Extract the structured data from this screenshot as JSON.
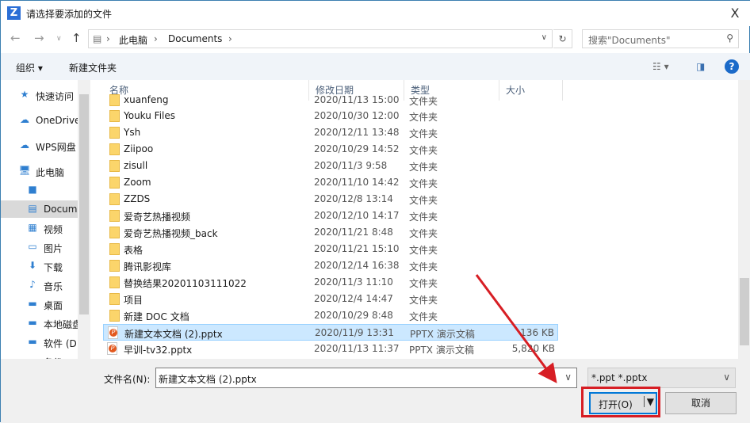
{
  "window": {
    "title": "请选择要添加的文件",
    "app_icon": "Z",
    "close": "X"
  },
  "address": {
    "root_icon": "document-icon",
    "crumbs": [
      "此电脑",
      "Documents"
    ],
    "search_placeholder": "搜索\"Documents\""
  },
  "toolbar": {
    "organize": "组织 ▾",
    "new_folder": "新建文件夹",
    "help": "?"
  },
  "sidebar": {
    "items": [
      {
        "label": "快速访问",
        "icon": "★"
      },
      {
        "label": "OneDrive",
        "icon": "☁"
      },
      {
        "label": "WPS网盘",
        "icon": "☁"
      },
      {
        "label": "此电脑",
        "icon": "🖥"
      },
      {
        "label": "",
        "icon": "■"
      },
      {
        "label": "Documents",
        "icon": "▤"
      },
      {
        "label": "视频",
        "icon": "▦"
      },
      {
        "label": "图片",
        "icon": "▭"
      },
      {
        "label": "下载",
        "icon": "⬇"
      },
      {
        "label": "音乐",
        "icon": "♪"
      },
      {
        "label": "桌面",
        "icon": "▬"
      },
      {
        "label": "本地磁盘",
        "icon": "▬"
      },
      {
        "label": "软件 (D",
        "icon": "▬"
      },
      {
        "label": "备份",
        "icon": "▬"
      }
    ]
  },
  "columns": {
    "name": "名称",
    "date": "修改日期",
    "type": "类型",
    "size": "大小"
  },
  "files": [
    {
      "name": "xuanfeng",
      "date": "2020/11/13 15:00",
      "type": "文件夹",
      "size": "",
      "kind": "folder"
    },
    {
      "name": "Youku Files",
      "date": "2020/10/30 12:00",
      "type": "文件夹",
      "size": "",
      "kind": "folder"
    },
    {
      "name": "Ysh",
      "date": "2020/12/11 13:48",
      "type": "文件夹",
      "size": "",
      "kind": "folder"
    },
    {
      "name": "Ziipoo",
      "date": "2020/10/29 14:52",
      "type": "文件夹",
      "size": "",
      "kind": "folder"
    },
    {
      "name": "zisull",
      "date": "2020/11/3 9:58",
      "type": "文件夹",
      "size": "",
      "kind": "folder"
    },
    {
      "name": "Zoom",
      "date": "2020/11/10 14:42",
      "type": "文件夹",
      "size": "",
      "kind": "folder"
    },
    {
      "name": "ZZDS",
      "date": "2020/12/8 13:14",
      "type": "文件夹",
      "size": "",
      "kind": "folder"
    },
    {
      "name": "爱奇艺热播视频",
      "date": "2020/12/10 14:17",
      "type": "文件夹",
      "size": "",
      "kind": "folder"
    },
    {
      "name": "爱奇艺热播视频_back",
      "date": "2020/11/21 8:48",
      "type": "文件夹",
      "size": "",
      "kind": "folder"
    },
    {
      "name": "表格",
      "date": "2020/11/21 15:10",
      "type": "文件夹",
      "size": "",
      "kind": "folder"
    },
    {
      "name": "腾讯影视库",
      "date": "2020/12/14 16:38",
      "type": "文件夹",
      "size": "",
      "kind": "folder"
    },
    {
      "name": "替换结果20201103111022",
      "date": "2020/11/3 11:10",
      "type": "文件夹",
      "size": "",
      "kind": "folder"
    },
    {
      "name": "项目",
      "date": "2020/12/4 14:47",
      "type": "文件夹",
      "size": "",
      "kind": "folder"
    },
    {
      "name": "新建 DOC 文档",
      "date": "2020/10/29 8:48",
      "type": "文件夹",
      "size": "",
      "kind": "folder"
    },
    {
      "name": "新建文本文档 (2).pptx",
      "date": "2020/11/9 13:31",
      "type": "PPTX 演示文稿",
      "size": "136 KB",
      "kind": "ppt",
      "selected": true
    },
    {
      "name": "早训-tv32.pptx",
      "date": "2020/11/13 11:37",
      "type": "PPTX 演示文稿",
      "size": "5,820 KB",
      "kind": "ppt"
    }
  ],
  "footer": {
    "filename_label": "文件名(N):",
    "filename_value": "新建文本文档 (2).pptx",
    "filter": "*.ppt *.pptx",
    "open": "打开(O)",
    "cancel": "取消"
  },
  "colors": {
    "accent": "#0078d7",
    "annotation": "#d71e24",
    "selection": "#cce8ff"
  }
}
